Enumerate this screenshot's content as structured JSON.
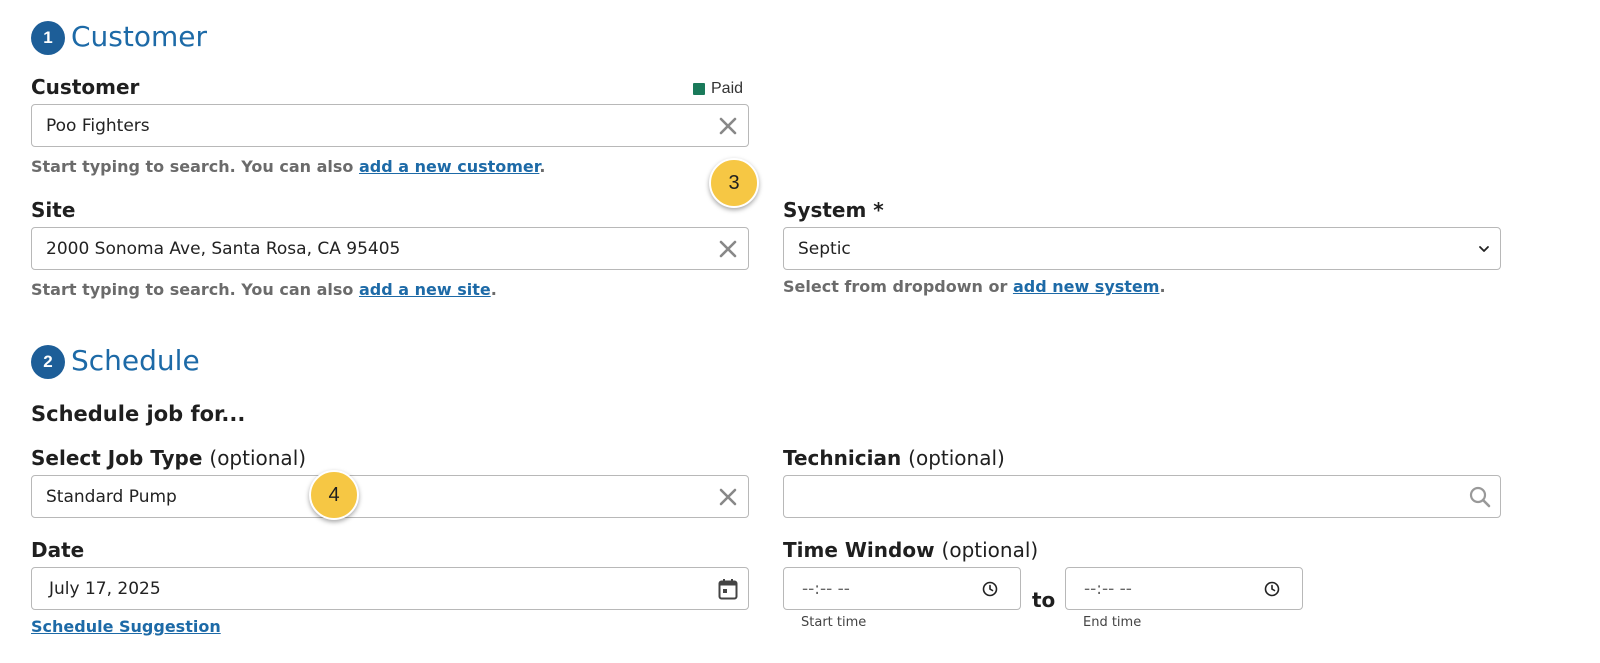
{
  "customer_section": {
    "step": "1",
    "title": "Customer",
    "customer_label": "Customer",
    "paid_status": "Paid",
    "paid_color": "#1a7a5a",
    "customer_value": "Poo Fighters",
    "customer_help_prefix": "Start typing to search. You can also ",
    "customer_help_link": "add a new customer",
    "customer_help_suffix": ".",
    "site_label": "Site",
    "site_value": "2000 Sonoma Ave, Santa Rosa, CA 95405",
    "site_help_prefix": "Start typing to search. You can also ",
    "site_help_link": "add a new site",
    "site_help_suffix": ".",
    "system_label": "System *",
    "system_value": "Septic",
    "system_help_prefix": "Select from dropdown or ",
    "system_help_link": "add new system",
    "system_help_suffix": "."
  },
  "schedule_section": {
    "step": "2",
    "title": "Schedule",
    "subheading": "Schedule job for...",
    "job_type_label": "Select Job Type",
    "job_type_optional": "(optional)",
    "job_type_value": "Standard Pump",
    "technician_label": "Technician",
    "technician_optional": "(optional)",
    "technician_value": "",
    "date_label": "Date",
    "date_value": "July 17, 2025",
    "schedule_suggestion_link": "Schedule Suggestion",
    "time_window_label": "Time Window",
    "time_window_optional": "(optional)",
    "start_time_placeholder": "--:-- --",
    "end_time_placeholder": "--:-- --",
    "to_label": "to",
    "start_time_caption": "Start time",
    "end_time_caption": "End time"
  },
  "callouts": [
    "3",
    "4"
  ],
  "colors": {
    "accent": "#1d6aa7",
    "badge": "#1d5e98",
    "callout": "#f6c744"
  }
}
